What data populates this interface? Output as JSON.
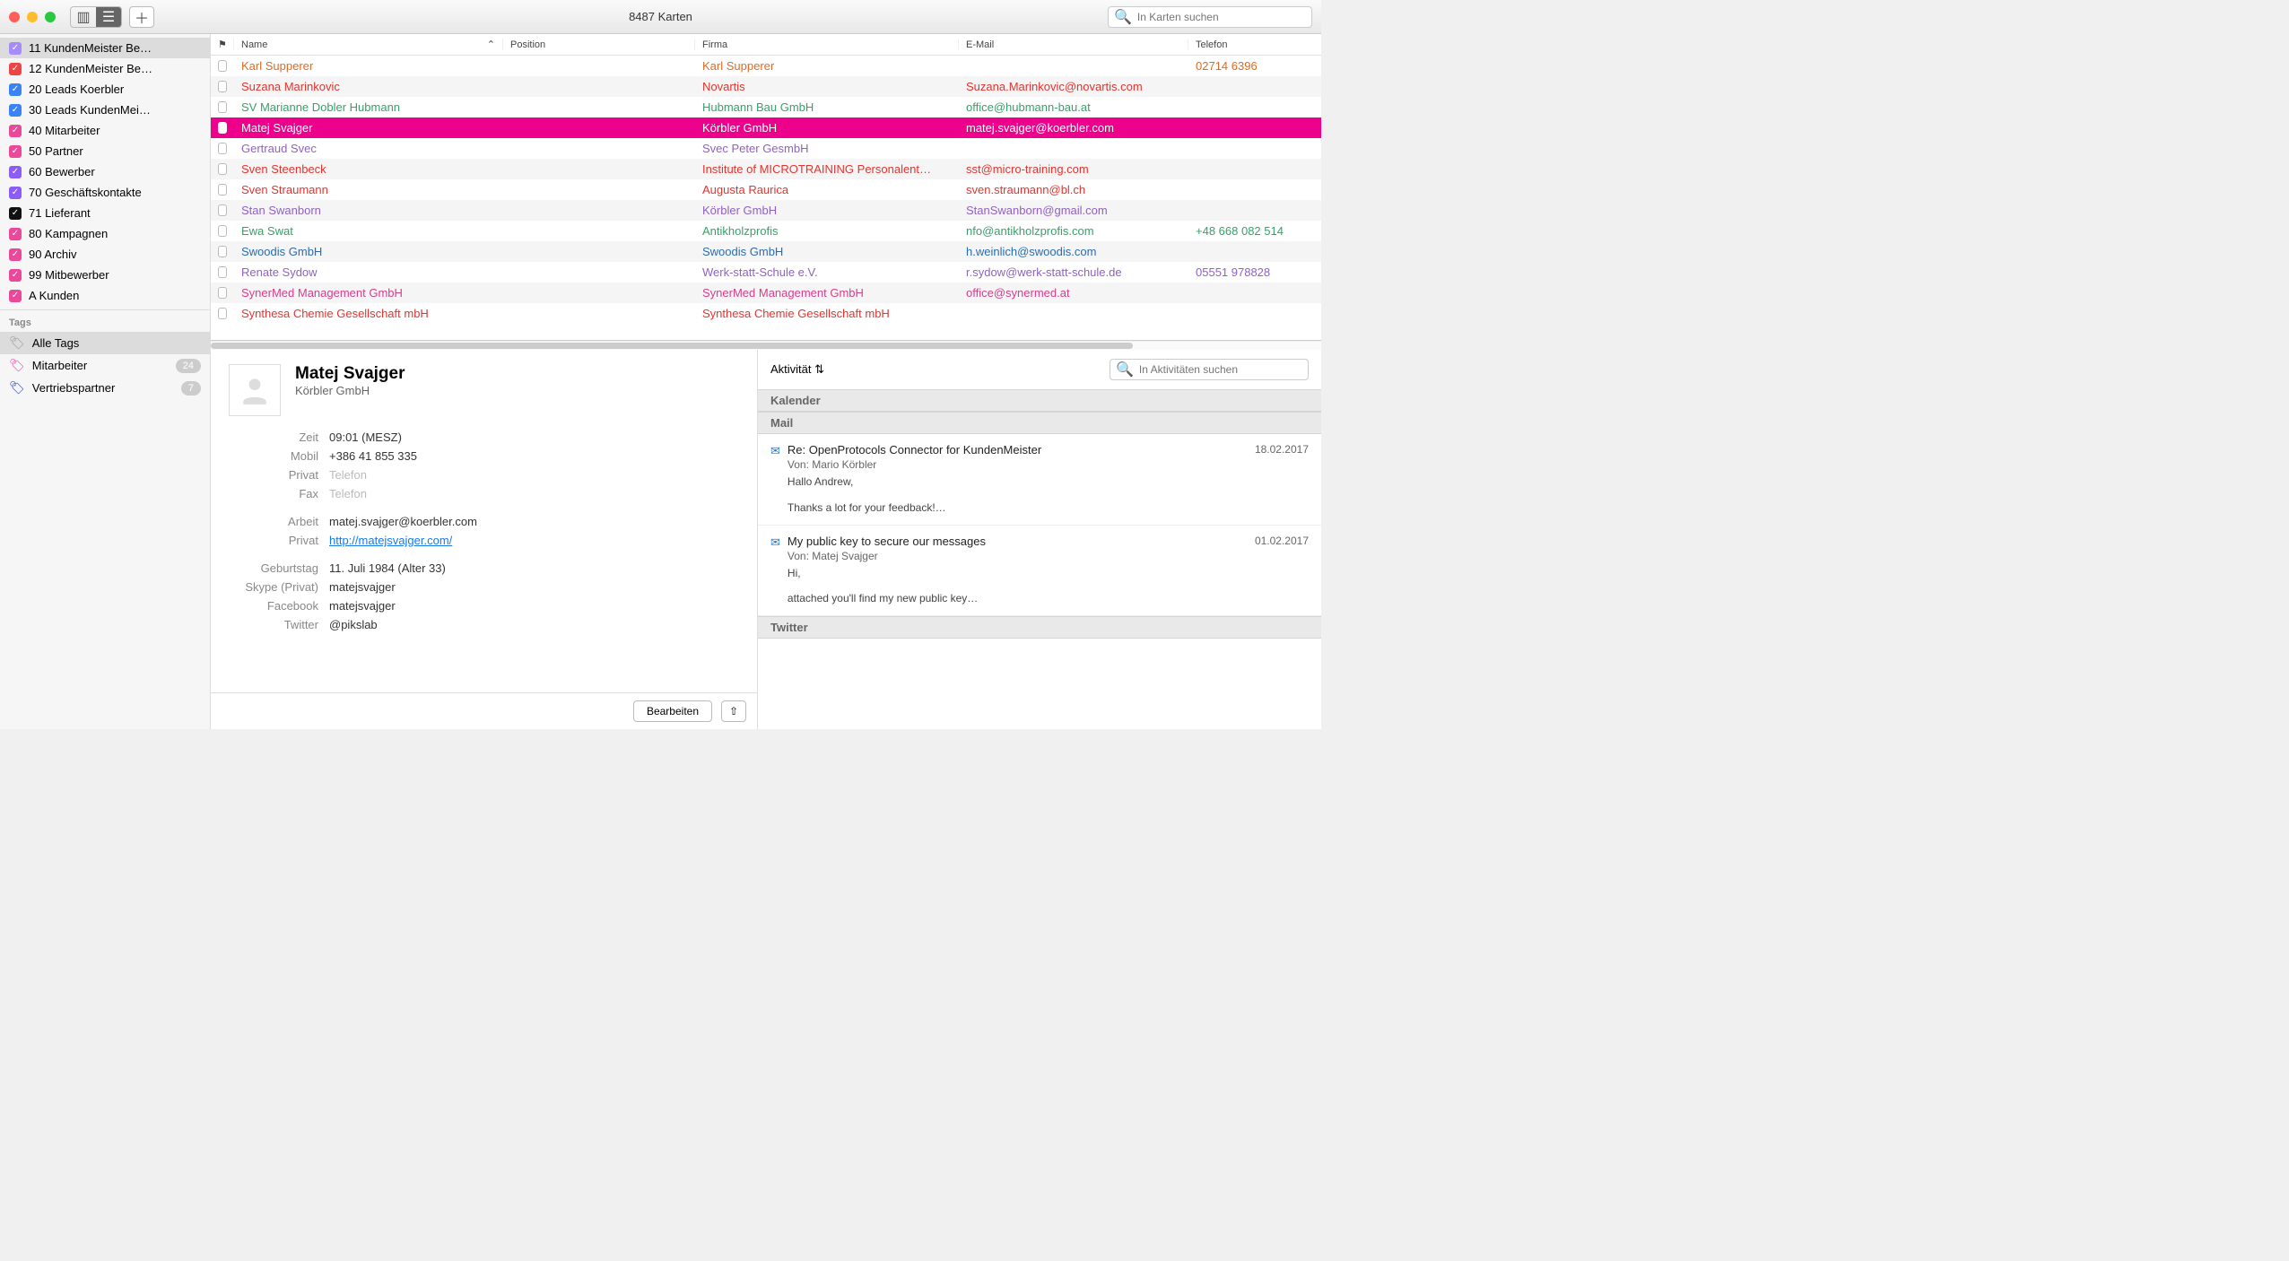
{
  "window": {
    "title": "8487 Karten"
  },
  "search": {
    "placeholder": "In Karten suchen"
  },
  "sidebar": {
    "groups": [
      {
        "label": "11 KundenMeister Be…",
        "color": "#a78bfa",
        "selected": true
      },
      {
        "label": "12 KundenMeister Be…",
        "color": "#ef4444"
      },
      {
        "label": "20 Leads Koerbler",
        "color": "#3b82f6"
      },
      {
        "label": "30 Leads KundenMei…",
        "color": "#3b82f6"
      },
      {
        "label": "40 Mitarbeiter",
        "color": "#ec4899"
      },
      {
        "label": "50 Partner",
        "color": "#ec4899"
      },
      {
        "label": "60 Bewerber",
        "color": "#8b5cf6"
      },
      {
        "label": "70 Geschäftskontakte",
        "color": "#8b5cf6"
      },
      {
        "label": "71 Lieferant",
        "color": "#111111"
      },
      {
        "label": "80 Kampagnen",
        "color": "#ec4899"
      },
      {
        "label": "90 Archiv",
        "color": "#ec4899"
      },
      {
        "label": "99 Mitbewerber",
        "color": "#ec4899"
      },
      {
        "label": "A Kunden",
        "color": "#ec4899"
      }
    ],
    "tags_header": "Tags",
    "tags": [
      {
        "label": "Alle Tags",
        "icon": "🏷",
        "color": "#999",
        "selected": true
      },
      {
        "label": "Mitarbeiter",
        "icon": "🏷",
        "color": "#ec4899",
        "badge": "24"
      },
      {
        "label": "Vertriebspartner",
        "icon": "🏷",
        "color": "#1e40af",
        "badge": "7"
      }
    ]
  },
  "columns": {
    "flag": "⚑",
    "name": "Name",
    "position": "Position",
    "firma": "Firma",
    "email": "E-Mail",
    "telefon": "Telefon"
  },
  "rows": [
    {
      "name": "Karl Supperer",
      "pos": "",
      "firm": "Karl Supperer",
      "mail": "",
      "tel": "02714 6396",
      "color": "orange"
    },
    {
      "name": "Suzana Marinkovic",
      "pos": "",
      "firm": "Novartis",
      "mail": "Suzana.Marinkovic@novartis.com",
      "tel": "",
      "color": "red"
    },
    {
      "name": "SV Marianne Dobler Hubmann",
      "pos": "",
      "firm": "Hubmann Bau GmbH",
      "mail": "office@hubmann-bau.at",
      "tel": "",
      "color": "green"
    },
    {
      "name": "Matej Svajger",
      "pos": "",
      "firm": "Körbler GmbH",
      "mail": "matej.svajger@koerbler.com",
      "tel": "",
      "color": "pink",
      "selected": true
    },
    {
      "name": "Gertraud Svec",
      "pos": "",
      "firm": "Svec Peter GesmbH",
      "mail": "",
      "tel": "",
      "color": "purple"
    },
    {
      "name": "Sven Steenbeck",
      "pos": "",
      "firm": "Institute of MICROTRAINING Personalent…",
      "mail": "sst@micro-training.com",
      "tel": "",
      "color": "red"
    },
    {
      "name": "Sven Straumann",
      "pos": "",
      "firm": "Augusta Raurica",
      "mail": "sven.straumann@bl.ch",
      "tel": "",
      "color": "red"
    },
    {
      "name": "Stan Swanborn",
      "pos": "",
      "firm": "Körbler GmbH",
      "mail": "StanSwanborn@gmail.com",
      "tel": "",
      "color": "purple"
    },
    {
      "name": "Ewa Swat",
      "pos": "",
      "firm": "Antikholzprofis",
      "mail": "nfo@antikholzprofis.com",
      "tel": "+48 668 082 514",
      "color": "green"
    },
    {
      "name": "Swoodis GmbH",
      "pos": "",
      "firm": "Swoodis GmbH",
      "mail": "h.weinlich@swoodis.com",
      "tel": "",
      "color": "blue"
    },
    {
      "name": "Renate Sydow",
      "pos": "",
      "firm": "Werk-statt-Schule e.V.",
      "mail": "r.sydow@werk-statt-schule.de",
      "tel": "05551 978828",
      "color": "purple"
    },
    {
      "name": "SynerMed Management GmbH",
      "pos": "",
      "firm": "SynerMed Management GmbH",
      "mail": "office@synermed.at",
      "tel": "",
      "color": "pink"
    },
    {
      "name": "Synthesa Chemie Gesellschaft mbH",
      "pos": "",
      "firm": "Synthesa Chemie Gesellschaft mbH",
      "mail": "",
      "tel": "",
      "color": "red"
    }
  ],
  "detail": {
    "name": "Matej Svajger",
    "company": "Körbler GmbH",
    "fields": [
      {
        "label": "Zeit",
        "value": "09:01 (MESZ)"
      },
      {
        "label": "Mobil",
        "value": "+386 41 855 335"
      },
      {
        "label": "Privat",
        "value": "Telefon",
        "muted": true
      },
      {
        "label": "Fax",
        "value": "Telefon",
        "muted": true
      },
      {
        "label": "Arbeit",
        "value": "matej.svajger@koerbler.com"
      },
      {
        "label": "Privat",
        "value": "http://matejsvajger.com/",
        "link": true
      },
      {
        "label": "Geburtstag",
        "value": "11. Juli 1984 (Alter 33)"
      },
      {
        "label": "Skype (Privat)",
        "value": "matejsvajger"
      },
      {
        "label": "Facebook",
        "value": "matejsvajger"
      },
      {
        "label": "Twitter",
        "value": "@pikslab"
      }
    ],
    "edit_button": "Bearbeiten"
  },
  "activity": {
    "selector": "Aktivität",
    "search_placeholder": "In Aktivitäten suchen",
    "sections": {
      "kalender": "Kalender",
      "mail": "Mail",
      "twitter": "Twitter"
    },
    "mails": [
      {
        "subject": "Re: OpenProtocols Connector for KundenMeister",
        "date": "18.02.2017",
        "from": "Von: Mario Körbler",
        "body1": "Hallo Andrew,",
        "body2": "Thanks a lot for your feedback!…"
      },
      {
        "subject": "My public key to secure our messages",
        "date": "01.02.2017",
        "from": "Von: Matej Svajger",
        "body1": "Hi,",
        "body2": "attached you'll find my new public key…"
      }
    ]
  }
}
